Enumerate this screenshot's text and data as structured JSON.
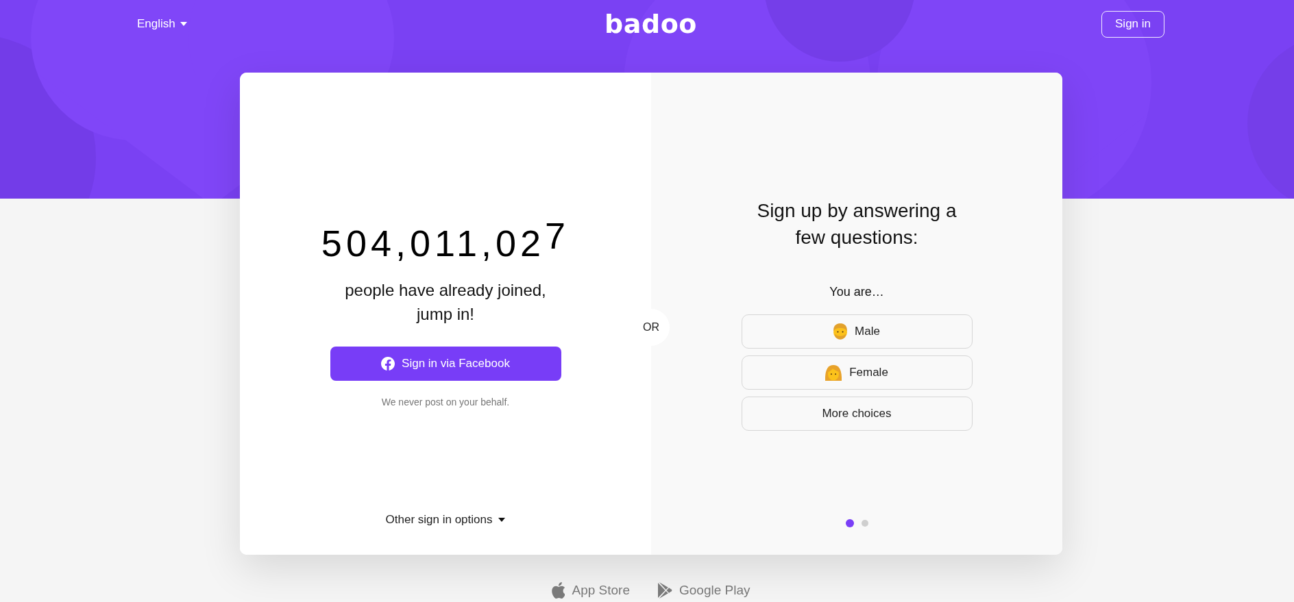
{
  "header": {
    "language": "English",
    "logo": "badoo",
    "sign_in": "Sign in"
  },
  "left_panel": {
    "counter": {
      "digits": "504,011,02",
      "rolling_digit": "7"
    },
    "caption": "people have already joined, jump in!",
    "facebook_button": "Sign in via Facebook",
    "note": "We never post on your behalf.",
    "other_options": "Other sign in options"
  },
  "divider_label": "OR",
  "right_panel": {
    "title": "Sign up by answering a few questions:",
    "prompt": "You are…",
    "choices": [
      {
        "label": "Male",
        "kind": "man"
      },
      {
        "label": "Female",
        "kind": "woman"
      },
      {
        "label": "More choices",
        "kind": "plain"
      }
    ],
    "pages": [
      {
        "selected": true
      },
      {
        "selected": false
      }
    ]
  },
  "footer": {
    "stores": [
      {
        "label": "App Store",
        "kind": "apple"
      },
      {
        "label": "Google Play",
        "kind": "play"
      }
    ]
  }
}
